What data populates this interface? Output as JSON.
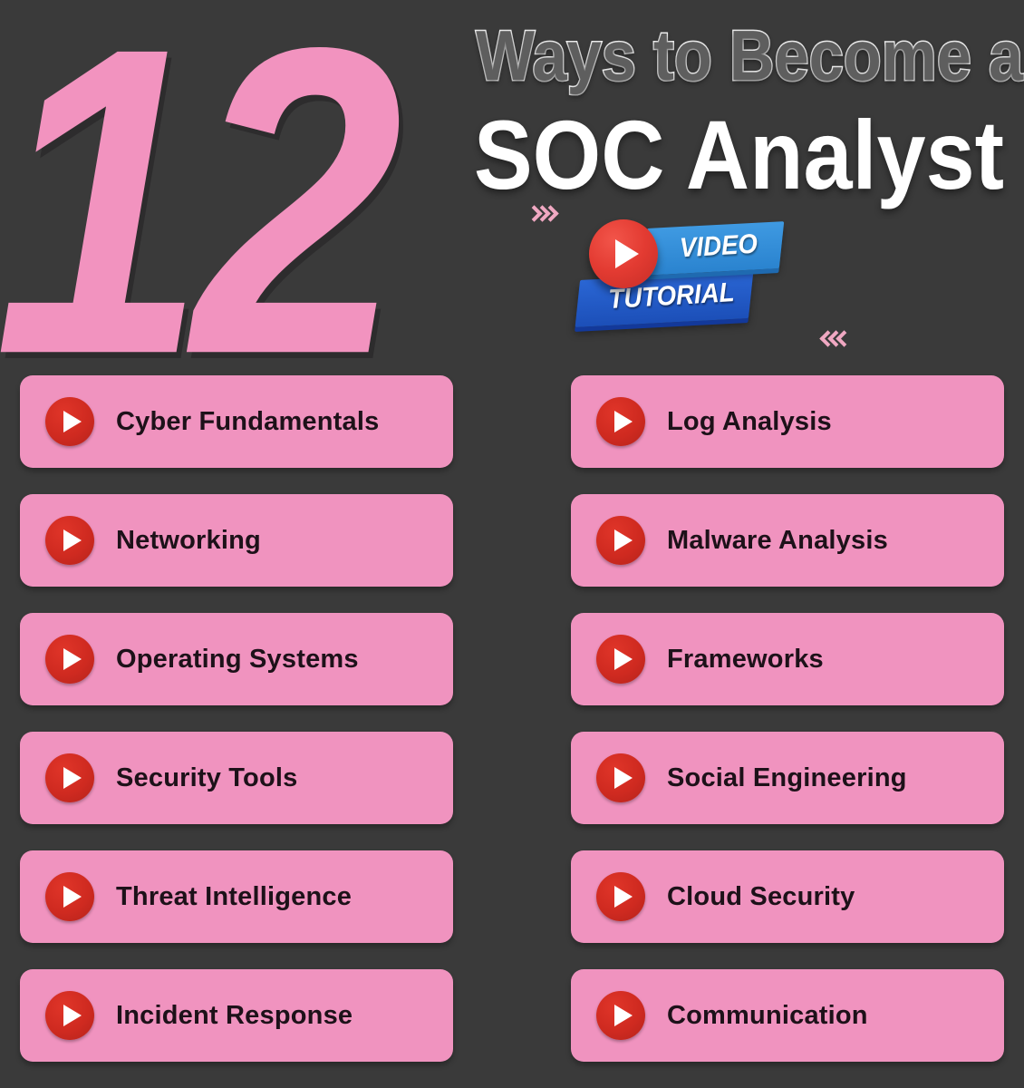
{
  "header": {
    "big_number": "12",
    "title_line_1": "Ways to Become a",
    "title_line_2": "SOC Analyst"
  },
  "video_badge": {
    "video_label": "VIDEO",
    "tutorial_label": "TUTORIAL",
    "play_icon": "play-icon",
    "video_box_color": "#3f9ae2",
    "tutorial_box_color": "#2a66d4",
    "play_circle_color": "#e33b32"
  },
  "decorations": {
    "chevrons_right": "»»»",
    "chevrons_left": "«««",
    "chevron_color": "#f0a8c2"
  },
  "theme": {
    "background": "#3a3a3a",
    "pill_background": "#f093bf",
    "pill_text": "#1d1119",
    "accent_pink": "#f293bf",
    "icon_red": "#cf2a20"
  },
  "list": {
    "left_column": [
      {
        "label": "Cyber Fundamentals",
        "icon": "play-icon"
      },
      {
        "label": "Networking",
        "icon": "play-icon"
      },
      {
        "label": "Operating Systems",
        "icon": "play-icon"
      },
      {
        "label": "Security Tools",
        "icon": "play-icon"
      },
      {
        "label": "Threat Intelligence",
        "icon": "play-icon"
      },
      {
        "label": "Incident Response",
        "icon": "play-icon"
      }
    ],
    "right_column": [
      {
        "label": "Log Analysis",
        "icon": "play-icon"
      },
      {
        "label": "Malware Analysis",
        "icon": "play-icon"
      },
      {
        "label": "Frameworks",
        "icon": "play-icon"
      },
      {
        "label": "Social Engineering",
        "icon": "play-icon"
      },
      {
        "label": "Cloud Security",
        "icon": "play-icon"
      },
      {
        "label": "Communication",
        "icon": "play-icon"
      }
    ]
  }
}
